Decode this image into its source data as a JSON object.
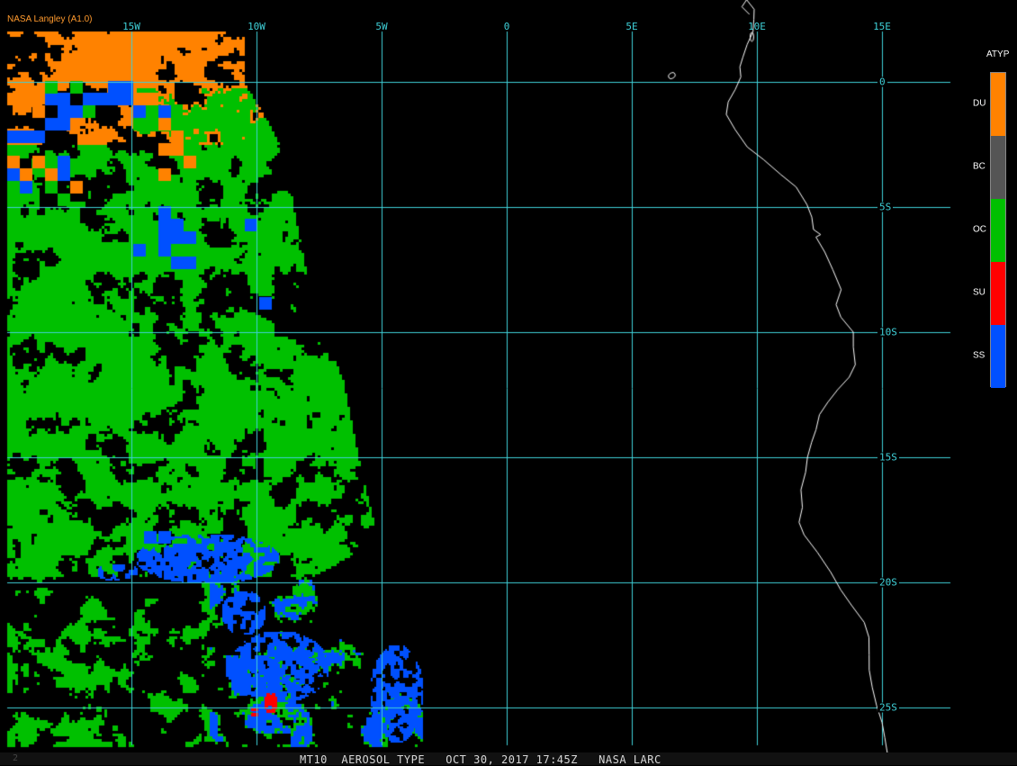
{
  "credit": "NASA Langley (A1.0)",
  "footer": {
    "caption": "MT10  AEROSOL TYPE   OCT 30, 2017 17:45Z   NASA LARC",
    "page_number": "2"
  },
  "axes": {
    "lon_ticks": [
      {
        "value": -15,
        "label": "15W"
      },
      {
        "value": -10,
        "label": "10W"
      },
      {
        "value": -5,
        "label": "5W"
      },
      {
        "value": 0,
        "label": "0"
      },
      {
        "value": 5,
        "label": "5E"
      },
      {
        "value": 10,
        "label": "10E"
      },
      {
        "value": 15,
        "label": "15E"
      }
    ],
    "lat_ticks": [
      {
        "value": 0,
        "label": "0"
      },
      {
        "value": -5,
        "label": "5S"
      },
      {
        "value": -10,
        "label": "10S"
      },
      {
        "value": -15,
        "label": "15S"
      },
      {
        "value": -20,
        "label": "20S"
      },
      {
        "value": -25,
        "label": "25S"
      }
    ],
    "grid_color": "#3fd0d8"
  },
  "legend": {
    "title": "ATYP",
    "items": [
      {
        "code": "DU",
        "color": "#ff8200"
      },
      {
        "code": "BC",
        "color": "#555555"
      },
      {
        "code": "OC",
        "color": "#00c000"
      },
      {
        "code": "SU",
        "color": "#ff0000"
      },
      {
        "code": "SS",
        "color": "#0050ff"
      }
    ]
  },
  "coastline_color": "#ffffff"
}
